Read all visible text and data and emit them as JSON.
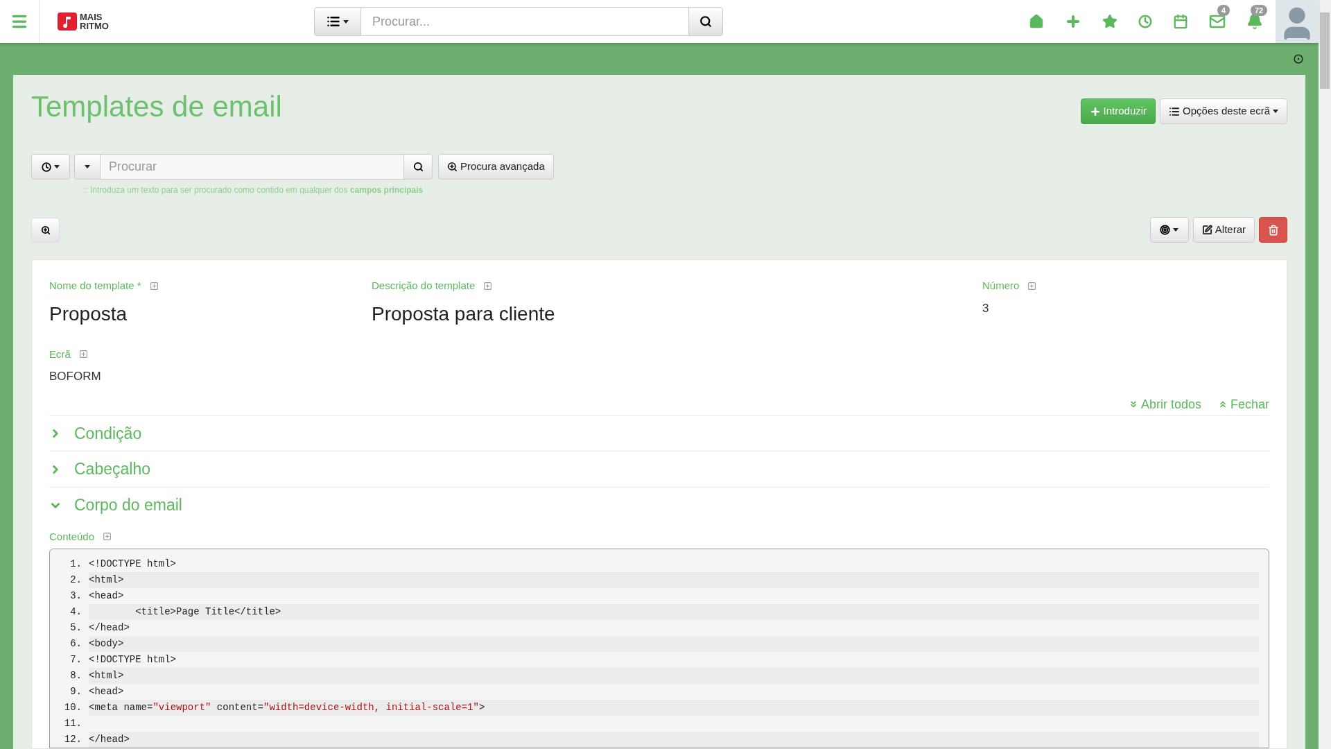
{
  "header": {
    "logo_text": [
      "MAIS",
      "RITMO"
    ],
    "search": {
      "placeholder": "Procurar..."
    },
    "badges": {
      "mail": "4",
      "notifications": "72"
    }
  },
  "page": {
    "title": "Templates de email",
    "actions": {
      "primary": "Introduzir",
      "options": "Opções deste ecrã"
    }
  },
  "search": {
    "placeholder": "Procurar",
    "advanced": "Procura avançada",
    "hint": ":: Introduza um texto para ser procurado como contido em qualquer dos **campos principais**"
  },
  "record_actions": {
    "edit": "Alterar"
  },
  "fields": [
    {
      "label": "Nome do template *",
      "value": "Proposta",
      "kind": "large"
    },
    {
      "label": "Descrição do template",
      "value": "Proposta para cliente",
      "kind": "large"
    },
    {
      "label": "Número",
      "value": "3",
      "kind": "small"
    },
    {
      "label": "Ecrã",
      "value": "BOFORM",
      "kind": "small"
    }
  ],
  "toggles": {
    "open_all": "Abrir todos",
    "close": "Fechar"
  },
  "sections": [
    {
      "title": "Condição",
      "expanded": false
    },
    {
      "title": "Cabeçalho",
      "expanded": false
    },
    {
      "title": "Corpo do email",
      "expanded": true
    }
  ],
  "content": {
    "label": "Conteúdo",
    "lines": [
      {
        "number": "1.",
        "tokens": [
          {
            "text": "<!DOCTYPE html>",
            "kind": "plain"
          }
        ]
      },
      {
        "number": "2.",
        "tokens": [
          {
            "text": "<html>",
            "kind": "plain"
          }
        ]
      },
      {
        "number": "3.",
        "tokens": [
          {
            "text": "<head>",
            "kind": "plain"
          }
        ]
      },
      {
        "number": "4.",
        "tokens": [
          {
            "text": "        <title>Page Title</title>",
            "kind": "plain"
          }
        ]
      },
      {
        "number": "5.",
        "tokens": [
          {
            "text": "</head>",
            "kind": "plain"
          }
        ]
      },
      {
        "number": "6.",
        "tokens": [
          {
            "text": "<body>",
            "kind": "plain"
          }
        ]
      },
      {
        "number": "7.",
        "tokens": [
          {
            "text": "<!DOCTYPE html>",
            "kind": "plain"
          }
        ]
      },
      {
        "number": "8.",
        "tokens": [
          {
            "text": "<html>",
            "kind": "plain"
          }
        ]
      },
      {
        "number": "9.",
        "tokens": [
          {
            "text": "<head>",
            "kind": "plain"
          }
        ]
      },
      {
        "number": "10.",
        "tokens": [
          {
            "text": "<meta name=",
            "kind": "plain"
          },
          {
            "text": "\"viewport\"",
            "kind": "string"
          },
          {
            "text": " content=",
            "kind": "plain"
          },
          {
            "text": "\"width=device-width, initial-scale=1\"",
            "kind": "string"
          },
          {
            "text": ">",
            "kind": "plain"
          }
        ]
      },
      {
        "number": "11."
      },
      {
        "number": "12.",
        "tokens": [
          {
            "text": "</head>",
            "kind": "plain"
          }
        ]
      }
    ]
  }
}
